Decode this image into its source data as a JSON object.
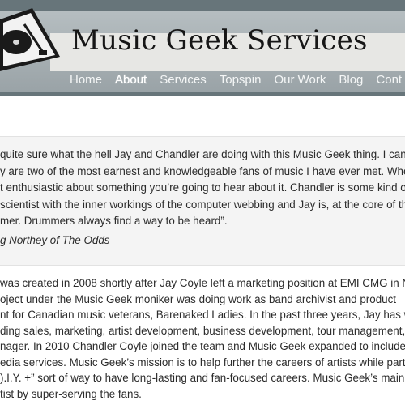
{
  "site": {
    "title": "Music Geek Services"
  },
  "nav": {
    "items": [
      {
        "label": "Home"
      },
      {
        "label": "About"
      },
      {
        "label": "Services"
      },
      {
        "label": "Topspin"
      },
      {
        "label": "Our Work"
      },
      {
        "label": "Blog"
      },
      {
        "label": "Cont"
      }
    ],
    "active": "About"
  },
  "quote": {
    "lines": [
      "quite sure what the hell Jay and Chandler are doing with this Music Geek thing. I can",
      "y are two of the most earnest and knowledgeable fans of music I have ever met. Whe",
      "t enthusiastic about something you’re going to hear about it. Chandler is some kind of",
      "scientist with the inner workings of the computer webbing and Jay is, at the core of thi",
      "mer. Drummers always find a way to be heard”."
    ],
    "attribution": "g Northey of The Odds"
  },
  "about": {
    "lines": [
      "was created in 2008 shortly after Jay Coyle left a marketing position at EMI CMG in N",
      "oject under the Music Geek moniker was doing work as band archivist and product",
      "nt for Canadian music veterans, Barenaked Ladies.  In the past three years, Jay has w",
      "ding sales, marketing, artist development, business development, tour management,",
      "nager.  In 2010 Chandler Coyle joined the team and Music Geek expanded to include",
      "edia services.  Music Geek’s mission is to help further the careers of artists while partn",
      ").I.Y. +” sort of way to have long-lasting and fan-focused careers. Music Geek’s main f",
      "tist by super-serving the fans."
    ]
  },
  "colors": {
    "header_dark": "#67757a",
    "header_light": "#b6bec1",
    "title_band": "#e7e7e4",
    "quote_bg": "#f4f4f4"
  }
}
